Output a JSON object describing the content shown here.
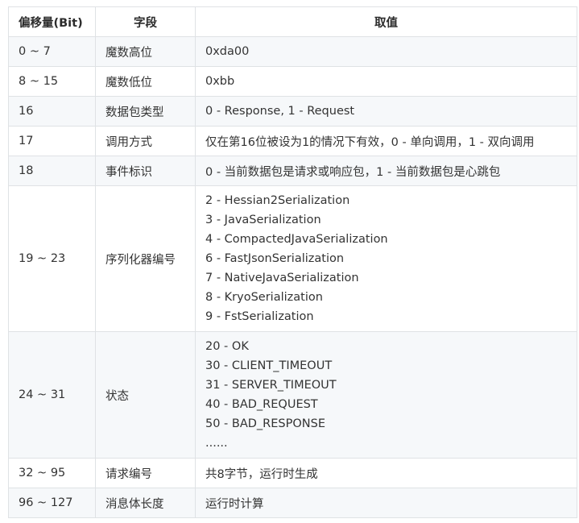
{
  "table": {
    "headers": [
      "偏移量(Bit)",
      "字段",
      "取值"
    ],
    "rows": [
      {
        "offset": "0 ~ 7",
        "field": "魔数高位",
        "value": [
          "0xda00"
        ]
      },
      {
        "offset": "8 ~ 15",
        "field": "魔数低位",
        "value": [
          "0xbb"
        ]
      },
      {
        "offset": "16",
        "field": "数据包类型",
        "value": [
          "0 - Response, 1 - Request"
        ]
      },
      {
        "offset": "17",
        "field": "调用方式",
        "value": [
          "仅在第16位被设为1的情况下有效，0 - 单向调用，1 - 双向调用"
        ]
      },
      {
        "offset": "18",
        "field": "事件标识",
        "value": [
          "0 - 当前数据包是请求或响应包，1 - 当前数据包是心跳包"
        ]
      },
      {
        "offset": "19 ~ 23",
        "field": "序列化器编号",
        "value": [
          "2 - Hessian2Serialization",
          "3 - JavaSerialization",
          "4 - CompactedJavaSerialization",
          "6 - FastJsonSerialization",
          "7 - NativeJavaSerialization",
          "8 - KryoSerialization",
          "9 - FstSerialization"
        ]
      },
      {
        "offset": "24 ~ 31",
        "field": "状态",
        "value": [
          "20 - OK",
          "30 - CLIENT_TIMEOUT",
          "31 - SERVER_TIMEOUT",
          "40 - BAD_REQUEST",
          "50 - BAD_RESPONSE",
          "......"
        ]
      },
      {
        "offset": "32 ~ 95",
        "field": "请求编号",
        "value": [
          "共8字节，运行时生成"
        ]
      },
      {
        "offset": "96 ~ 127",
        "field": "消息体长度",
        "value": [
          "运行时计算"
        ]
      }
    ]
  }
}
